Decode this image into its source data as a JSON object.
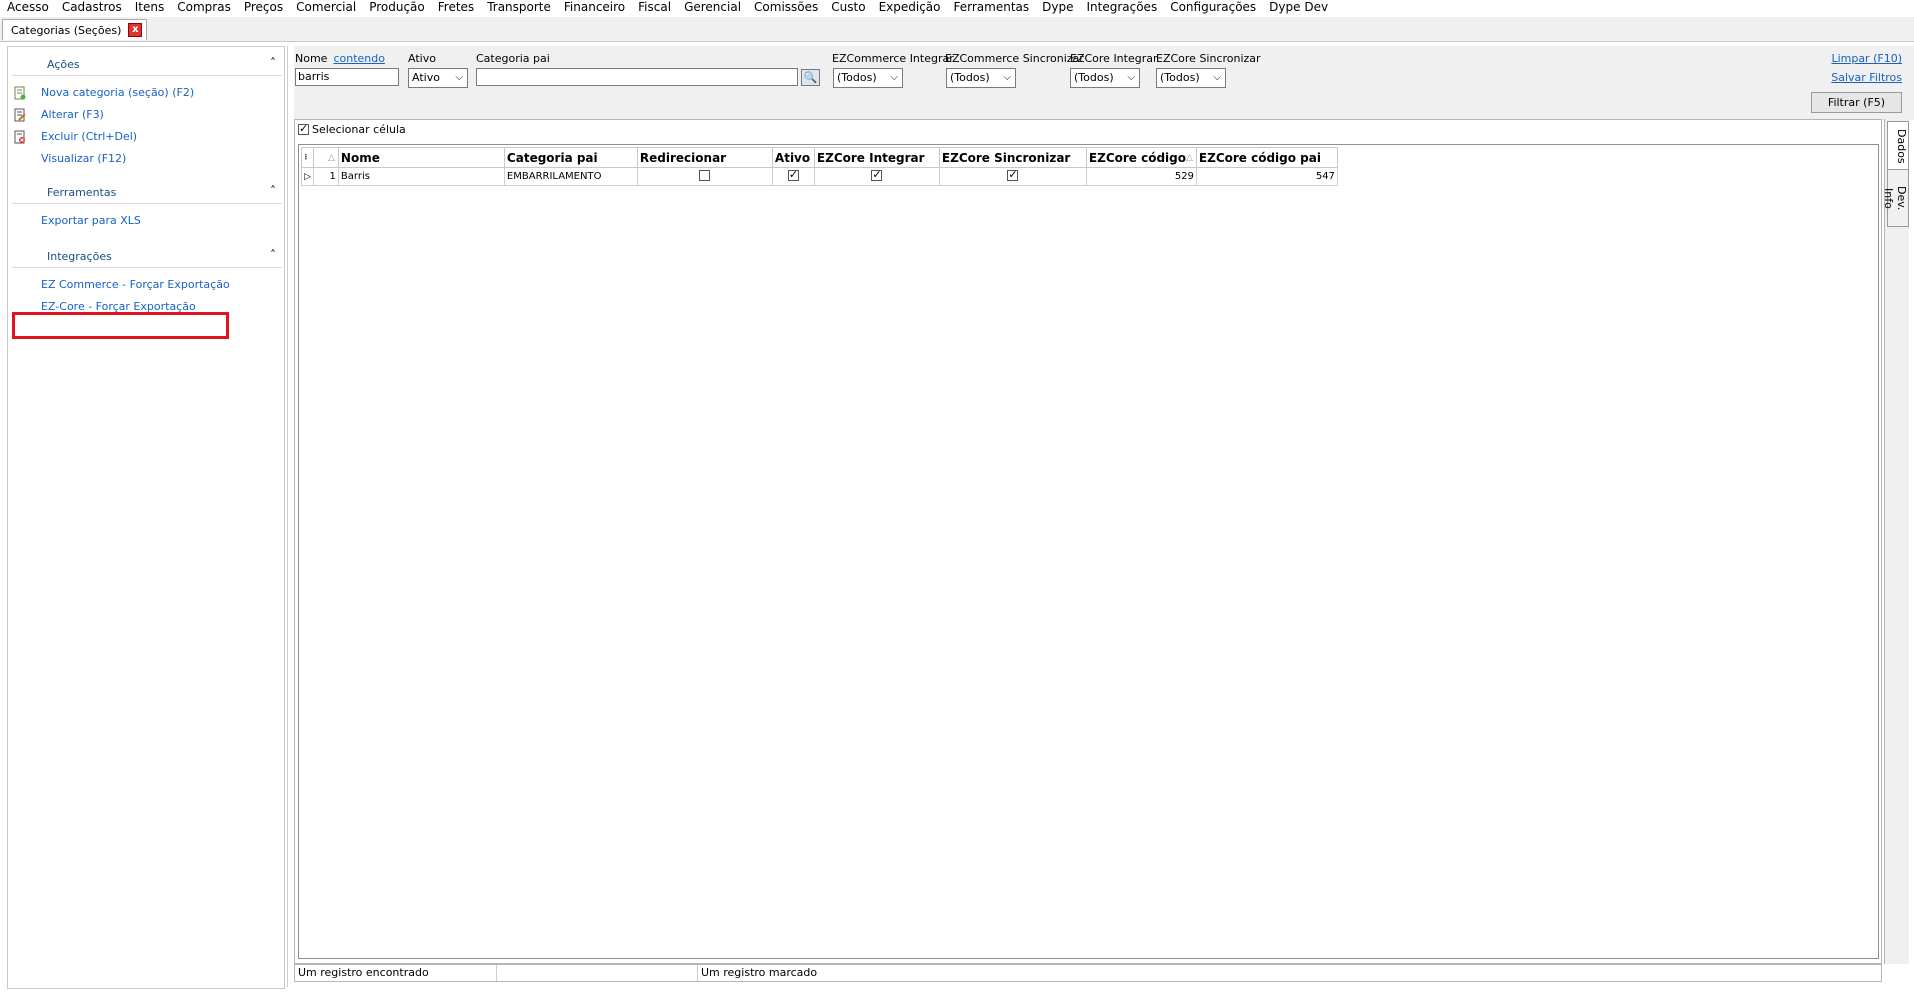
{
  "menu": [
    "Acesso",
    "Cadastros",
    "Itens",
    "Compras",
    "Preços",
    "Comercial",
    "Produção",
    "Fretes",
    "Transporte",
    "Financeiro",
    "Fiscal",
    "Gerencial",
    "Comissões",
    "Custo",
    "Expedição",
    "Ferramentas",
    "Dype",
    "Integrações",
    "Configurações",
    "Dype Dev"
  ],
  "tab": {
    "label": "Categorias (Seções)",
    "close": "x"
  },
  "sidebar": {
    "acoes": {
      "title": "Ações",
      "items": [
        "Nova categoria (seção) (F2)",
        "Alterar (F3)",
        "Excluir (Ctrl+Del)",
        "Visualizar (F12)"
      ]
    },
    "ferramentas": {
      "title": "Ferramentas",
      "items": [
        "Exportar para XLS"
      ]
    },
    "integracoes": {
      "title": "Integrações",
      "items": [
        "EZ Commerce - Forçar Exportação",
        "EZ-Core - Forçar Exportação"
      ]
    }
  },
  "filters": {
    "nome_label": "Nome",
    "nome_mode": "contendo",
    "nome_value": "barris",
    "ativo_label": "Ativo",
    "ativo_value": "Ativo",
    "categoria_pai_label": "Categoria pai",
    "categoria_pai_value": "",
    "ezcommerce_integrar_label": "EZCommerce Integrar",
    "ezcommerce_integrar_value": "(Todos)",
    "ezcommerce_sincronizar_label": "EZCommerce Sincronizar",
    "ezcommerce_sincronizar_value": "(Todos)",
    "ezcore_integrar_label": "EZCore Integrar",
    "ezcore_integrar_value": "(Todos)",
    "ezcore_sincronizar_label": "EZCore Sincronizar",
    "ezcore_sincronizar_value": "(Todos)",
    "limpar": "Limpar (F10)",
    "salvar": "Salvar Filtros",
    "filtrar": "Filtrar (F5)"
  },
  "select_cell": {
    "label": "Selecionar célula",
    "checked": true
  },
  "grid": {
    "columns": [
      "Nome",
      "Categoria pai",
      "Redirecionar",
      "Ativo",
      "EZCore Integrar",
      "EZCore Sincronizar",
      "EZCore código",
      "EZCore código pai"
    ],
    "rows": [
      {
        "num": "1",
        "nome": "Barris",
        "categoria_pai": "EMBARRILAMENTO",
        "redirecionar": false,
        "ativo": true,
        "ezcore_integrar": true,
        "ezcore_sincronizar": true,
        "ezcore_codigo": "529",
        "ezcore_codigo_pai": "547"
      }
    ]
  },
  "side_tabs": [
    "Dados",
    "Dev. Info"
  ],
  "status": {
    "left": "Um registro encontrado",
    "middle": "",
    "right": "Um registro marcado"
  },
  "colors": {
    "link": "#1561c7",
    "highlight": "#e0141e"
  }
}
